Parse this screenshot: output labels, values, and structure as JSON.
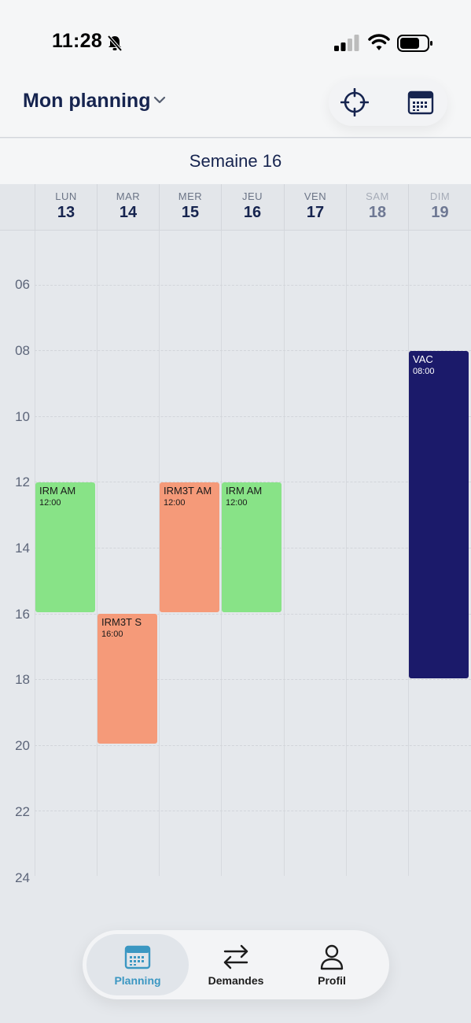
{
  "status_bar": {
    "time": "11:28",
    "icons": [
      "bell-slash-icon",
      "signal-icon",
      "wifi-icon",
      "battery-icon"
    ]
  },
  "header": {
    "title": "Mon planning",
    "dropdown_icon": "chevron-down-icon",
    "actions": [
      "crosshair-icon",
      "calendar-icon"
    ]
  },
  "week": {
    "label": "Semaine 16"
  },
  "days": [
    {
      "name": "LUN",
      "date": "13"
    },
    {
      "name": "MAR",
      "date": "14"
    },
    {
      "name": "MER",
      "date": "15"
    },
    {
      "name": "JEU",
      "date": "16"
    },
    {
      "name": "VEN",
      "date": "17"
    },
    {
      "name": "SAM",
      "date": "18"
    },
    {
      "name": "DIM",
      "date": "19"
    }
  ],
  "hours": [
    "06",
    "08",
    "10",
    "12",
    "14",
    "16",
    "18",
    "20",
    "22",
    "24"
  ],
  "events": [
    {
      "day": "LUN",
      "title": "IRM AM",
      "time": "12:00",
      "start": 12,
      "end": 16,
      "color": "#88e387"
    },
    {
      "day": "MAR",
      "title": "IRM3T S",
      "time": "16:00",
      "start": 16,
      "end": 20,
      "color": "#f59a79"
    },
    {
      "day": "MER",
      "title": "IRM3T AM",
      "time": "12:00",
      "start": 12,
      "end": 16,
      "color": "#f59a79"
    },
    {
      "day": "JEU",
      "title": "IRM AM",
      "time": "12:00",
      "start": 12,
      "end": 16,
      "color": "#88e387"
    },
    {
      "day": "DIM",
      "title": "VAC",
      "time": "08:00",
      "start": 8,
      "end": 18,
      "color": "#1b1a6a"
    }
  ],
  "nav": {
    "planning": {
      "label": "Planning",
      "icon": "calendar-icon",
      "active": true
    },
    "demandes": {
      "label": "Demandes",
      "icon": "swap-arrows-icon"
    },
    "profil": {
      "label": "Profil",
      "icon": "user-icon"
    }
  },
  "colors": {
    "accent": "#3b97c2",
    "navy": "#16244f",
    "green": "#88e387",
    "salmon": "#f59a79",
    "vacation": "#1b1a6a"
  }
}
